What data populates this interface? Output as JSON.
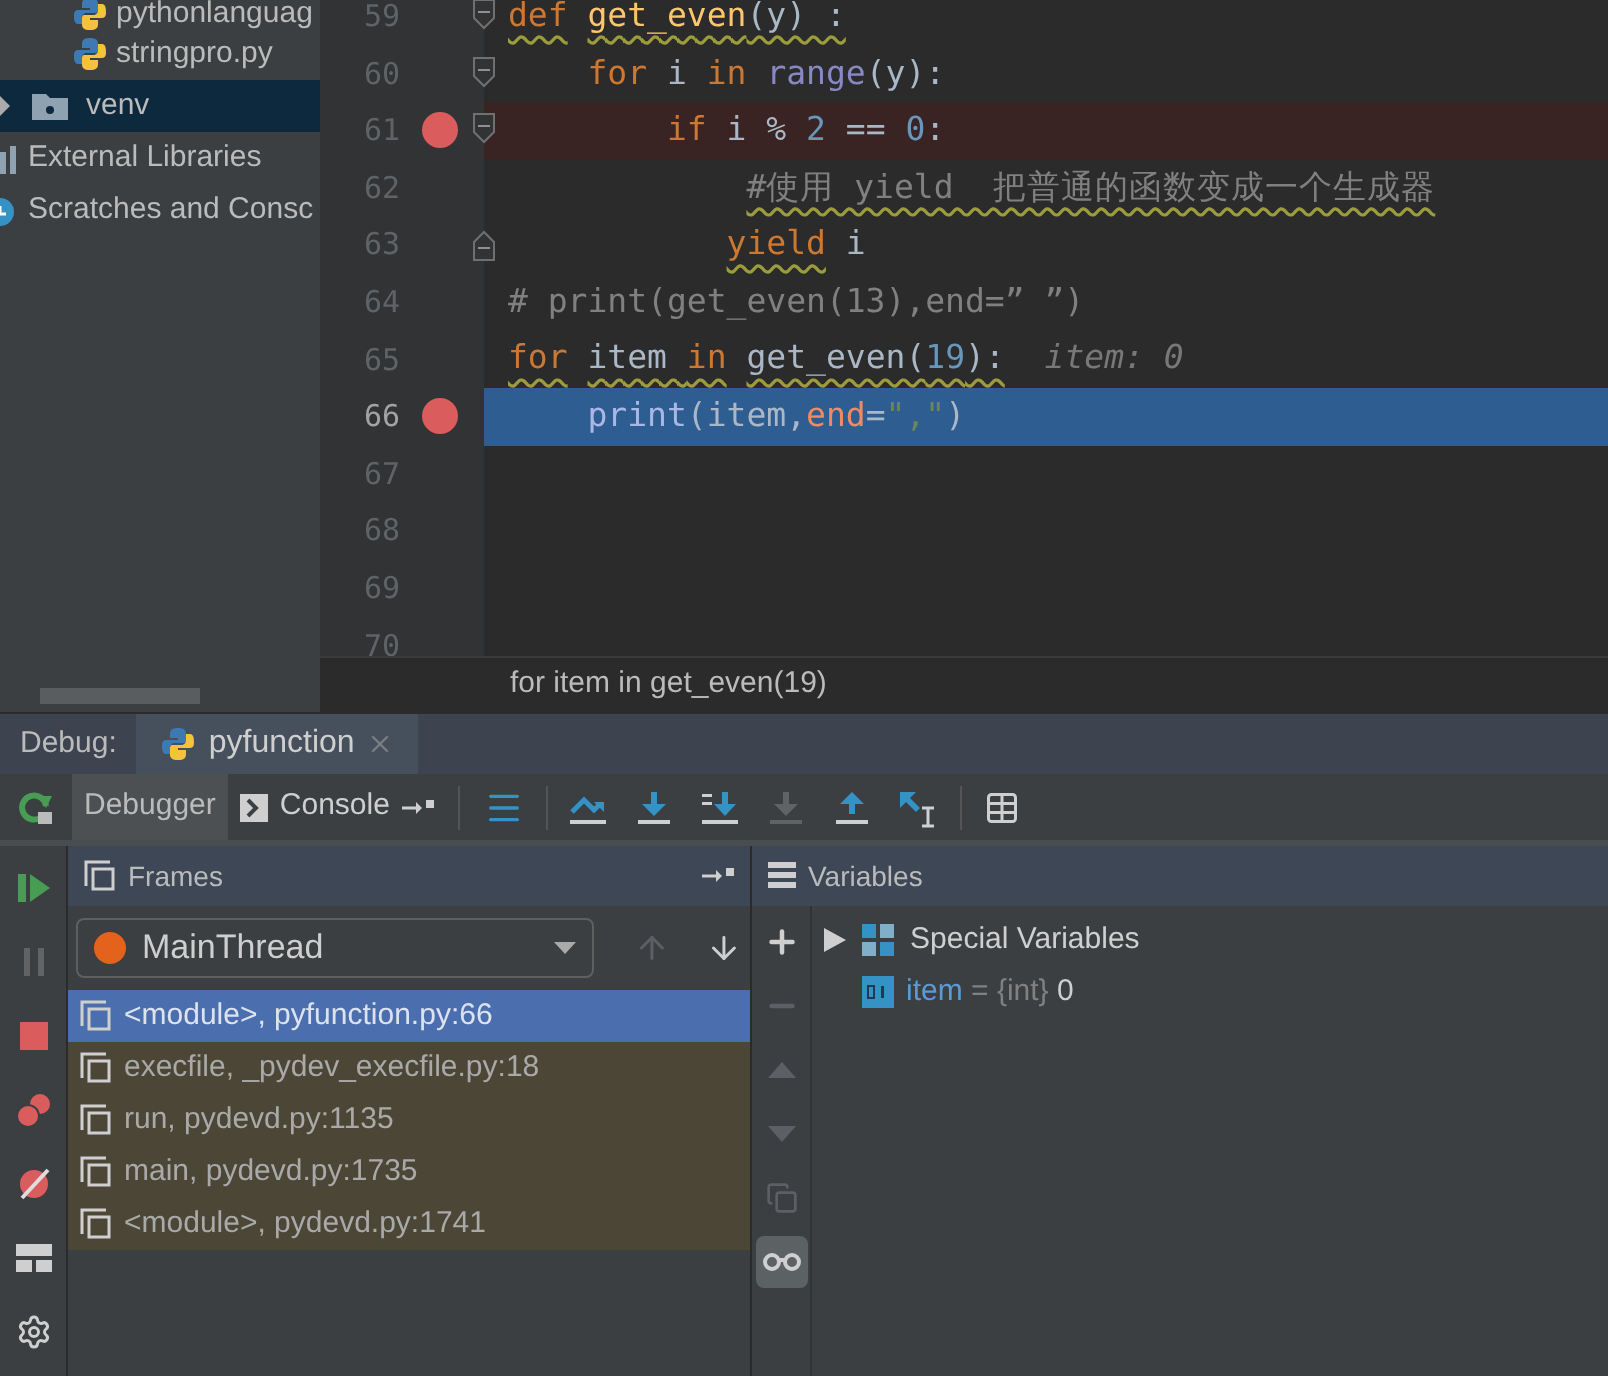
{
  "project_tree": {
    "open_folder_children": [
      {
        "label": "pythonlanguag",
        "kind": "python_file"
      },
      {
        "label": "stringpro.py",
        "kind": "python_file"
      }
    ],
    "items": [
      {
        "label": "venv",
        "kind": "folder",
        "expanded": false,
        "selected": true
      },
      {
        "label": "External Libraries",
        "kind": "libraries",
        "selected": false
      },
      {
        "label": "Scratches and Consc",
        "kind": "scratches",
        "selected": false
      }
    ]
  },
  "editor": {
    "lines": [
      {
        "number": "59",
        "breakpoint": false,
        "current": false,
        "fold_open": true,
        "tokens": [
          {
            "text": "def",
            "kind": "keyword",
            "squiggle": true
          },
          {
            "text": " get_even",
            "kind": "function",
            "squiggle": true
          },
          {
            "text": "(y) :",
            "kind": "plain",
            "squiggle": true
          }
        ]
      },
      {
        "number": "60",
        "breakpoint": false,
        "current": false,
        "fold_open": true,
        "tokens": [
          {
            "text": "    for",
            "kind": "keyword"
          },
          {
            "text": " i ",
            "kind": "plain"
          },
          {
            "text": "in",
            "kind": "keyword"
          },
          {
            "text": " range",
            "kind": "builtin"
          },
          {
            "text": "(y):",
            "kind": "plain"
          }
        ]
      },
      {
        "number": "61",
        "breakpoint": true,
        "current": false,
        "fold_open": true,
        "tokens": [
          {
            "text": "        if",
            "kind": "keyword"
          },
          {
            "text": " i % ",
            "kind": "plain"
          },
          {
            "text": "2",
            "kind": "number"
          },
          {
            "text": " == ",
            "kind": "plain"
          },
          {
            "text": "0",
            "kind": "number"
          },
          {
            "text": ":",
            "kind": "plain"
          }
        ]
      },
      {
        "number": "62",
        "breakpoint": false,
        "current": false,
        "tokens": [
          {
            "text": "            #使用 yield  把普通的函数变成一个生成器",
            "kind": "comment",
            "squiggle": true
          }
        ]
      },
      {
        "number": "63",
        "breakpoint": false,
        "current": false,
        "fold_close": true,
        "tokens": [
          {
            "text": "           yield",
            "kind": "keyword",
            "squiggle": true
          },
          {
            "text": " i",
            "kind": "plain"
          }
        ]
      },
      {
        "number": "64",
        "breakpoint": false,
        "current": false,
        "tokens": [
          {
            "text": "# print(get_even(13),end=” ”)",
            "kind": "comment"
          }
        ]
      },
      {
        "number": "65",
        "breakpoint": false,
        "current": false,
        "tokens": [
          {
            "text": "for",
            "kind": "keyword",
            "squiggle": true
          },
          {
            "text": " item ",
            "kind": "plain",
            "squiggle": true
          },
          {
            "text": "in",
            "kind": "keyword",
            "squiggle": true
          },
          {
            "text": " get_even(",
            "kind": "plain",
            "squiggle": true
          },
          {
            "text": "19",
            "kind": "number",
            "squiggle": true
          },
          {
            "text": "):",
            "kind": "plain",
            "squiggle": true
          },
          {
            "text": "  item: 0",
            "kind": "hint"
          }
        ]
      },
      {
        "number": "66",
        "breakpoint": true,
        "current": true,
        "tokens": [
          {
            "text": "    print",
            "kind": "builtin"
          },
          {
            "text": "(item,",
            "kind": "plain"
          },
          {
            "text": "end",
            "kind": "param"
          },
          {
            "text": "=",
            "kind": "plain"
          },
          {
            "text": "\",\"",
            "kind": "string"
          },
          {
            "text": ")",
            "kind": "plain"
          }
        ]
      },
      {
        "number": "67",
        "breakpoint": false,
        "current": false
      },
      {
        "number": "68",
        "breakpoint": false,
        "current": false
      },
      {
        "number": "69",
        "breakpoint": false,
        "current": false
      },
      {
        "number": "70",
        "breakpoint": false,
        "current": false
      }
    ],
    "breadcrumb": "for item in get_even(19)"
  },
  "debug": {
    "label": "Debug:",
    "tabs": [
      {
        "label": "pyfunction",
        "selected": true
      }
    ],
    "view_tabs": [
      {
        "label": "Debugger",
        "kind": "debugger",
        "selected": true
      },
      {
        "label": "Console",
        "kind": "console",
        "selected": false
      }
    ],
    "toolbar": [
      {
        "kind": "frames_menu",
        "disabled": false
      },
      {
        "kind": "step_over",
        "disabled": false
      },
      {
        "kind": "step_into",
        "disabled": false
      },
      {
        "kind": "step_into_my_code",
        "disabled": false
      },
      {
        "kind": "force_step_into",
        "disabled": true
      },
      {
        "kind": "step_out",
        "disabled": false
      },
      {
        "kind": "run_to_cursor",
        "disabled": false
      },
      {
        "kind": "evaluate",
        "disabled": false
      }
    ],
    "side_toolbar": [
      {
        "kind": "resume",
        "disabled": false
      },
      {
        "kind": "pause",
        "disabled": true
      },
      {
        "kind": "stop",
        "disabled": false
      },
      {
        "kind": "view_breakpoints",
        "disabled": false
      },
      {
        "kind": "mute_breakpoints",
        "disabled": false
      },
      {
        "kind": "layout",
        "disabled": false
      },
      {
        "kind": "settings",
        "disabled": false
      }
    ],
    "frames": {
      "title": "Frames",
      "thread": "MainThread",
      "up_disabled": true,
      "down_disabled": false,
      "items": [
        {
          "label": "<module>, pyfunction.py:66",
          "selected": true,
          "library": false
        },
        {
          "label": "execfile, _pydev_execfile.py:18",
          "selected": false,
          "library": true
        },
        {
          "label": "run, pydevd.py:1135",
          "selected": false,
          "library": true
        },
        {
          "label": "main, pydevd.py:1735",
          "selected": false,
          "library": true
        },
        {
          "label": "<module>, pydevd.py:1741",
          "selected": false,
          "library": true
        }
      ]
    },
    "variables": {
      "title": "Variables",
      "toolbar": [
        {
          "kind": "add",
          "disabled": false
        },
        {
          "kind": "remove",
          "disabled": true
        },
        {
          "kind": "up",
          "disabled": true
        },
        {
          "kind": "down",
          "disabled": true
        },
        {
          "kind": "copy",
          "disabled": true
        },
        {
          "kind": "watches",
          "selected": true
        }
      ],
      "items": [
        {
          "kind": "group",
          "label": "Special Variables",
          "expanded": false
        },
        {
          "kind": "value",
          "name": "item",
          "operator": "=",
          "type": "{int}",
          "value": "0"
        }
      ]
    }
  }
}
